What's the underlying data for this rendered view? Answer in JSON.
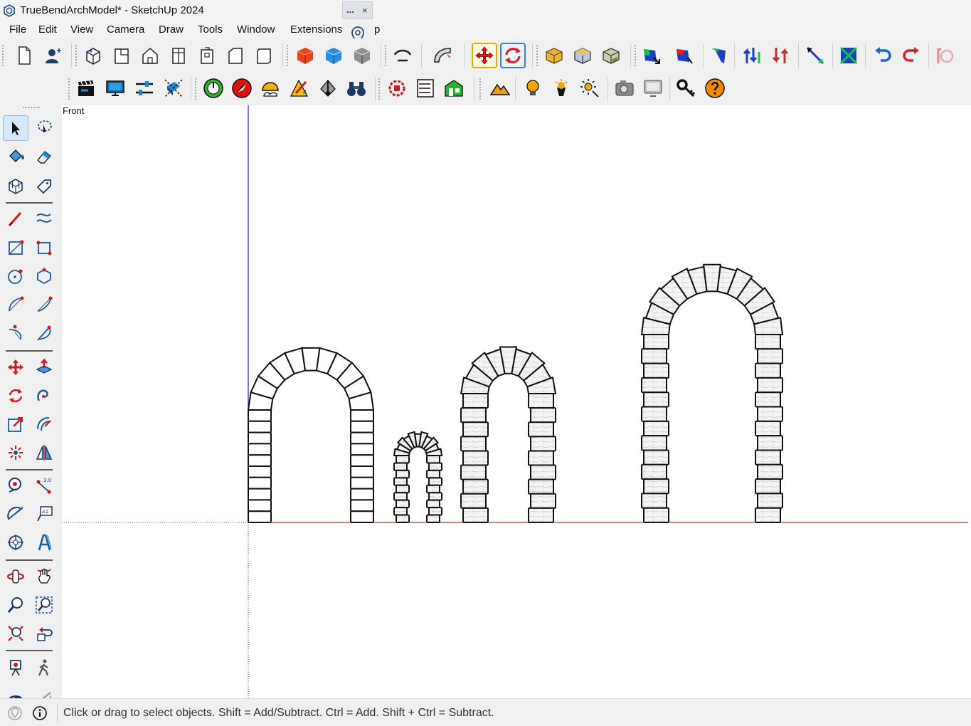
{
  "window": {
    "title": "TrueBendArchModel* - SketchUp 2024"
  },
  "menu": [
    "File",
    "Edit",
    "View",
    "Camera",
    "Draw",
    "Tools",
    "Window",
    "Extensions",
    "p"
  ],
  "floating_panel": {
    "dots": "...",
    "close": "×"
  },
  "viewport": {
    "scene_label": "Front"
  },
  "status": {
    "message": "Click or drag to select objects. Shift = Add/Subtract. Ctrl = Add. Shift + Ctrl = Subtract."
  },
  "colors": {
    "red_axis": "#c0302a",
    "blue_axis": "#1a22c8",
    "selected_tool": "#d8e8fa",
    "active_move": "#f2a600",
    "active_rotate": "#3c7fd6"
  },
  "icons": {
    "toolbar_row1": [
      "new-file-icon",
      "account-icon",
      "iso-view-icon",
      "top-view-icon",
      "front-view-icon",
      "right-view-icon",
      "back-view-icon",
      "left-view-icon",
      "bottom-view-icon",
      "paint-cube-red-icon",
      "paint-cube-blue-icon",
      "paint-cube-gray-icon",
      "follow-me-icon",
      "true-bend-icon",
      "move-icon",
      "rotate-icon",
      "solid-union-icon",
      "solid-subtract-icon",
      "solid-trim-icon",
      "reverse-faces-icon",
      "orient-faces-icon",
      "extension-icon-1",
      "extension-icon-2",
      "extension-icon-3",
      "extension-icon-4",
      "extension-icon-5",
      "undo-icon",
      "redo-icon",
      "extension-icon-6"
    ],
    "toolbar_row2": [
      "animation-icon",
      "display-icon",
      "settings-sliders-icon",
      "styles-icon",
      "geo-location-icon",
      "compass-icon",
      "shadows-icon",
      "pencil-ruler-icon",
      "section-plane-icon",
      "binoculars-icon",
      "components-icon",
      "outliner-icon",
      "warehouse-icon",
      "terrain-icon",
      "light-bulb-icon",
      "spotlight-icon",
      "sun-light-icon",
      "camera-icon",
      "screen-icon",
      "key-icon",
      "help-icon"
    ],
    "left_toolbar": [
      "select-icon",
      "lasso-select-icon",
      "paint-bucket-icon",
      "eraser-icon",
      "make-component-icon",
      "tag-icon",
      "line-icon",
      "freehand-icon",
      "rectangle-icon",
      "rotated-rectangle-icon",
      "circle-icon",
      "polygon-icon",
      "arc-icon",
      "two-point-arc-icon",
      "three-point-arc-icon",
      "pie-icon",
      "move-icon",
      "push-pull-icon",
      "rotate-icon",
      "follow-me-icon",
      "scale-icon",
      "offset-icon",
      "explode-icon",
      "flip-icon",
      "tape-measure-icon",
      "dimension-icon",
      "protractor-icon",
      "text-icon",
      "axes-icon",
      "3d-text-icon",
      "orbit-icon",
      "pan-icon",
      "zoom-icon",
      "zoom-window-icon",
      "zoom-extents-icon",
      "previous-view-icon",
      "position-camera-icon",
      "walk-icon",
      "look-around-icon",
      "section-icon"
    ]
  }
}
